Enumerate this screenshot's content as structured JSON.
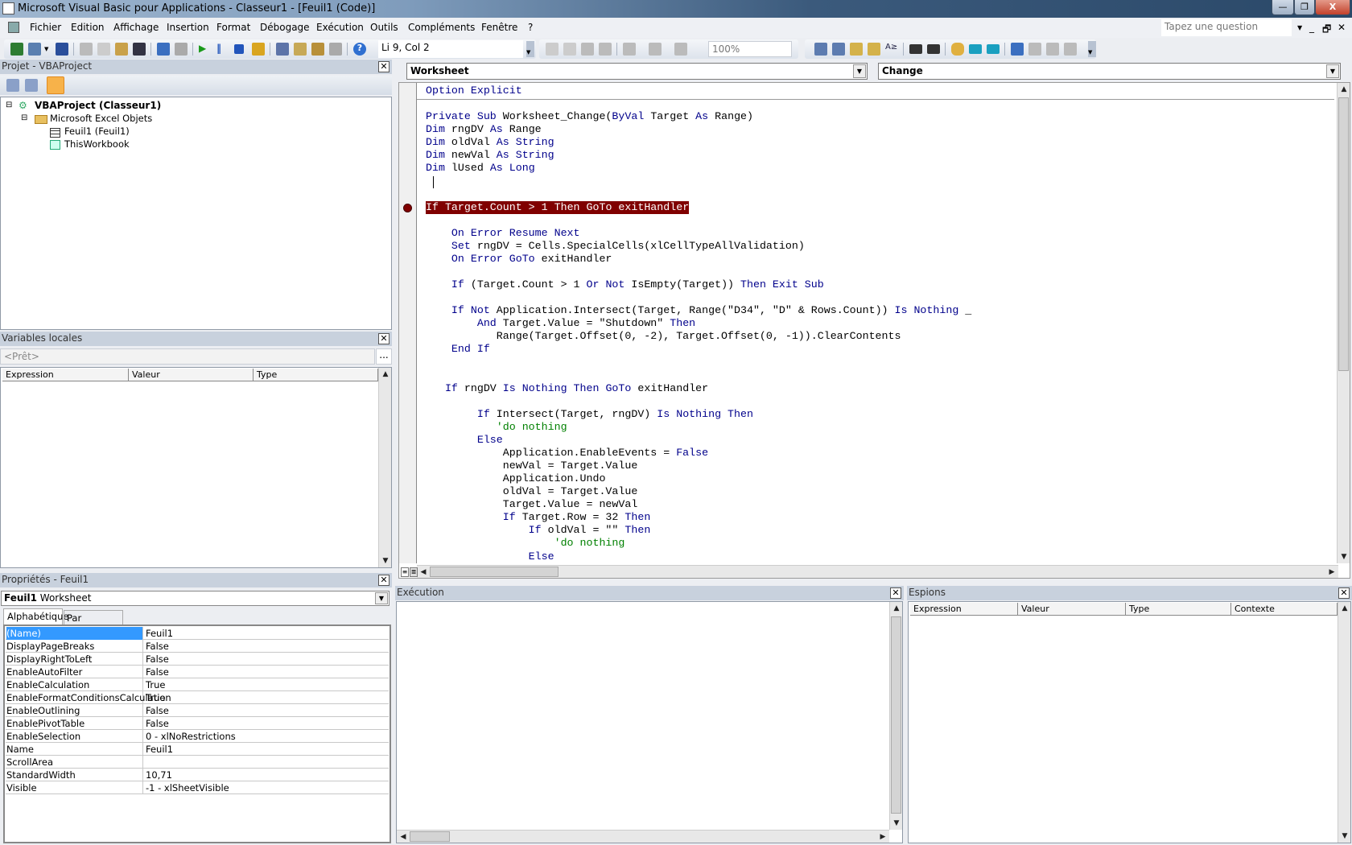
{
  "window": {
    "title": "Microsoft Visual Basic pour Applications - Classeur1 - [Feuil1 (Code)]",
    "min": "—",
    "restore": "❐",
    "close": "X"
  },
  "menu": {
    "items": [
      "Fichier",
      "Edition",
      "Affichage",
      "Insertion",
      "Format",
      "Débogage",
      "Exécution",
      "Outils",
      "Compléments",
      "Fenêtre",
      "?"
    ],
    "question_placeholder": "Tapez une question",
    "mdi_min": "_",
    "mdi_restore": "🗗",
    "mdi_close": "✕"
  },
  "toolbar": {
    "position": "Li 9, Col 2",
    "zoom": "100%"
  },
  "project": {
    "title": "Projet - VBAProject",
    "root": "VBAProject (Classeur1)",
    "folder": "Microsoft Excel Objets",
    "items": [
      "Feuil1 (Feuil1)",
      "ThisWorkbook"
    ]
  },
  "locals": {
    "title": "Variables locales",
    "status": "<Prêt>",
    "more": "...",
    "columns": [
      "Expression",
      "Valeur",
      "Type"
    ]
  },
  "properties": {
    "title": "Propriétés - Feuil1",
    "object_name": "Feuil1",
    "object_type": "Worksheet",
    "tabs": [
      "Alphabétique",
      "Par catégorie"
    ],
    "rows": [
      [
        "(Name)",
        "Feuil1"
      ],
      [
        "DisplayPageBreaks",
        "False"
      ],
      [
        "DisplayRightToLeft",
        "False"
      ],
      [
        "EnableAutoFilter",
        "False"
      ],
      [
        "EnableCalculation",
        "True"
      ],
      [
        "EnableFormatConditionsCalculation",
        "True"
      ],
      [
        "EnableOutlining",
        "False"
      ],
      [
        "EnablePivotTable",
        "False"
      ],
      [
        "EnableSelection",
        "0 - xlNoRestrictions"
      ],
      [
        "Name",
        "Feuil1"
      ],
      [
        "ScrollArea",
        ""
      ],
      [
        "StandardWidth",
        "10,71"
      ],
      [
        "Visible",
        "-1 - xlSheetVisible"
      ]
    ]
  },
  "code": {
    "object": "Worksheet",
    "procedure": "Change",
    "breakpoint_line": 9,
    "lines": [
      [
        [
          "k",
          "Option Explicit"
        ]
      ],
      [],
      [
        [
          "k",
          "Private Sub "
        ],
        [
          "p",
          "Worksheet_Change("
        ],
        [
          "k",
          "ByVal "
        ],
        [
          "p",
          "Target "
        ],
        [
          "k",
          "As "
        ],
        [
          "p",
          "Range)"
        ]
      ],
      [
        [
          "k",
          "Dim "
        ],
        [
          "p",
          "rngDV "
        ],
        [
          "k",
          "As "
        ],
        [
          "p",
          "Range"
        ]
      ],
      [
        [
          "k",
          "Dim "
        ],
        [
          "p",
          "oldVal "
        ],
        [
          "k",
          "As String"
        ]
      ],
      [
        [
          "k",
          "Dim "
        ],
        [
          "p",
          "newVal "
        ],
        [
          "k",
          "As String"
        ]
      ],
      [
        [
          "k",
          "Dim "
        ],
        [
          "p",
          "lUsed "
        ],
        [
          "k",
          "As Long"
        ]
      ],
      [],
      [],
      [
        [
          "k",
          "If "
        ],
        [
          "p",
          "Target.Count > 1 "
        ],
        [
          "k",
          "Then GoTo "
        ],
        [
          "p",
          "exitHandler"
        ]
      ],
      [],
      [
        [
          "k",
          "    On Error Resume Next"
        ]
      ],
      [
        [
          "k",
          "    Set "
        ],
        [
          "p",
          "rngDV = Cells.SpecialCells(xlCellTypeAllValidation)"
        ]
      ],
      [
        [
          "k",
          "    On Error GoTo "
        ],
        [
          "p",
          "exitHandler"
        ]
      ],
      [],
      [
        [
          "k",
          "    If "
        ],
        [
          "p",
          "(Target.Count > 1 "
        ],
        [
          "k",
          "Or Not "
        ],
        [
          "p",
          "IsEmpty(Target)) "
        ],
        [
          "k",
          "Then Exit Sub"
        ]
      ],
      [],
      [
        [
          "k",
          "    If Not "
        ],
        [
          "p",
          "Application.Intersect(Target, Range(\"D34\", \"D\" & Rows.Count)) "
        ],
        [
          "k",
          "Is Nothing "
        ],
        [
          "p",
          "_"
        ]
      ],
      [
        [
          "k",
          "        And "
        ],
        [
          "p",
          "Target.Value = \"Shutdown\" "
        ],
        [
          "k",
          "Then"
        ]
      ],
      [
        [
          "p",
          "           Range(Target.Offset(0, -2), Target.Offset(0, -1)).ClearContents"
        ]
      ],
      [
        [
          "k",
          "    End If"
        ]
      ],
      [],
      [],
      [
        [
          "k",
          "   If "
        ],
        [
          "p",
          "rngDV "
        ],
        [
          "k",
          "Is Nothing Then GoTo "
        ],
        [
          "p",
          "exitHandler"
        ]
      ],
      [],
      [
        [
          "k",
          "        If "
        ],
        [
          "p",
          "Intersect(Target, rngDV) "
        ],
        [
          "k",
          "Is Nothing Then"
        ]
      ],
      [
        [
          "c",
          "           'do nothing"
        ]
      ],
      [
        [
          "k",
          "        Else"
        ]
      ],
      [
        [
          "p",
          "            Application.EnableEvents = "
        ],
        [
          "k",
          "False"
        ]
      ],
      [
        [
          "p",
          "            newVal = Target.Value"
        ]
      ],
      [
        [
          "p",
          "            Application.Undo"
        ]
      ],
      [
        [
          "p",
          "            oldVal = Target.Value"
        ]
      ],
      [
        [
          "p",
          "            Target.Value = newVal"
        ]
      ],
      [
        [
          "k",
          "            If "
        ],
        [
          "p",
          "Target.Row = 32 "
        ],
        [
          "k",
          "Then"
        ]
      ],
      [
        [
          "k",
          "                If "
        ],
        [
          "p",
          "oldVal = \"\" "
        ],
        [
          "k",
          "Then"
        ]
      ],
      [
        [
          "c",
          "                    'do nothing"
        ]
      ],
      [
        [
          "k",
          "                Else"
        ]
      ]
    ]
  },
  "immediate": {
    "title": "Exécution"
  },
  "watches": {
    "title": "Espions",
    "columns": [
      "Expression",
      "Valeur",
      "Type",
      "Contexte"
    ]
  },
  "colors": {
    "breakpoint": "#800000",
    "keyword": "#00008b",
    "comment": "#008000",
    "selection": "#3399ff"
  }
}
